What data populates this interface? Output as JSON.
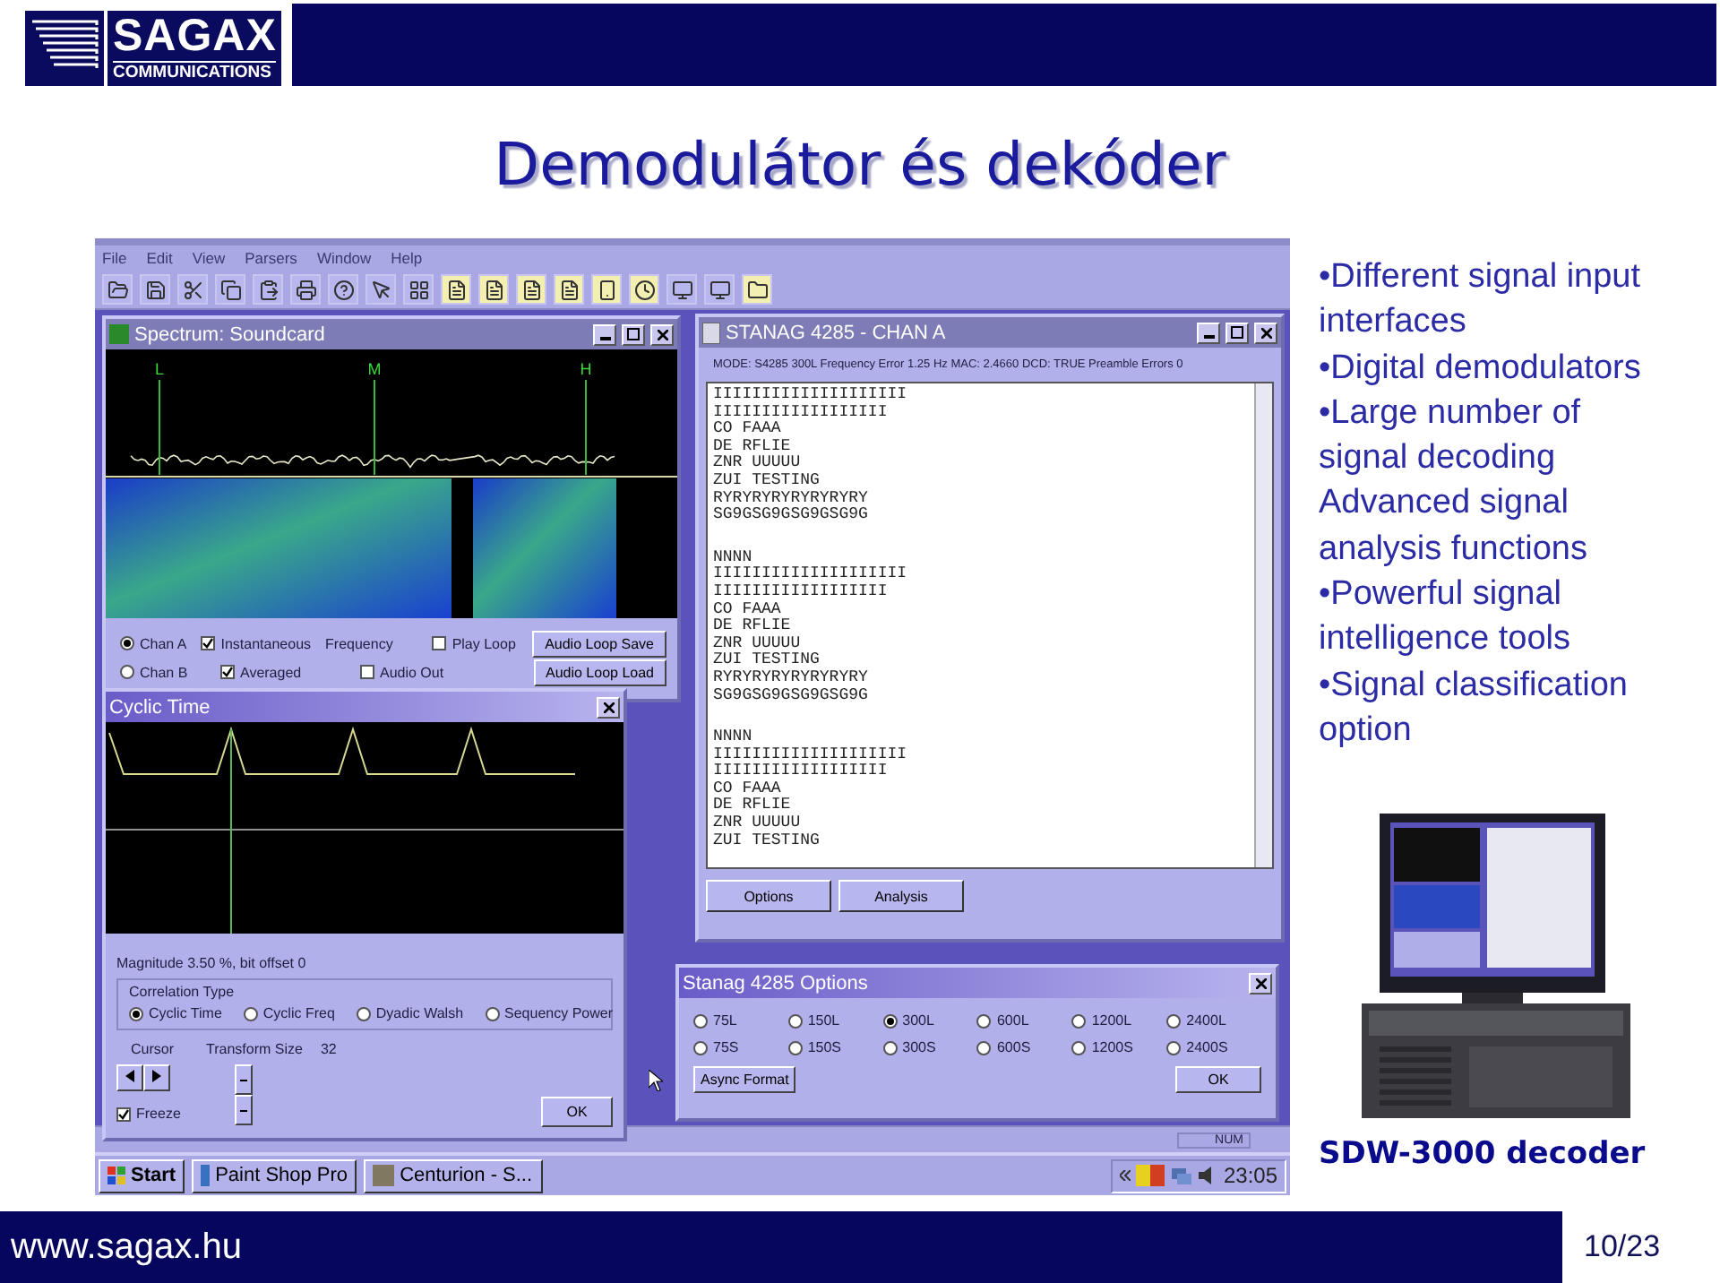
{
  "header": {
    "logo_name": "SAGAX",
    "logo_subtitle": "COMMUNICATIONS"
  },
  "title": "Demodulátor és dekóder",
  "app": {
    "menu": [
      "File",
      "Edit",
      "View",
      "Parsers",
      "Window",
      "Help"
    ],
    "spectrum": {
      "title": "Spectrum: Soundcard",
      "markers": [
        "L",
        "M",
        "H"
      ],
      "controls": [
        [
          {
            "kind": "radio",
            "label": "Chan A",
            "selected": true
          },
          {
            "kind": "checkbox",
            "label": "Instantaneous",
            "checked": true
          },
          {
            "kind": "label",
            "label": "Frequency"
          },
          {
            "kind": "checkbox",
            "label": "Play Loop",
            "checked": false
          },
          {
            "kind": "button",
            "label": "Audio Loop Save"
          }
        ],
        [
          {
            "kind": "radio",
            "label": "Chan B",
            "selected": false
          },
          {
            "kind": "checkbox",
            "label": "Averaged",
            "checked": true
          },
          {
            "kind": "checkbox",
            "label": "Audio Out",
            "checked": false
          },
          {
            "kind": "button",
            "label": "Audio Loop Load"
          }
        ]
      ]
    },
    "stanag": {
      "title": "STANAG 4285 - CHAN A",
      "status": "MODE: S4285 300L Frequency Error 1.25 Hz MAC: 2.4660 DCD: TRUE Preamble Errors 0",
      "blocks": [
        [
          "IIIIIIIIIIIIIIIIIIII",
          "IIIIIIIIIIIIIIIIII",
          "CO FAAA",
          "DE RFLIE",
          "ZNR UUUUU",
          "ZUI TESTING",
          "RYRYRYRYRYRYRYRY",
          "SG9GSG9GSG9GSG9G"
        ],
        [
          "NNNN",
          "IIIIIIIIIIIIIIIIIIII",
          "IIIIIIIIIIIIIIIIII",
          "CO FAAA",
          "DE RFLIE",
          "ZNR UUUUU",
          "ZUI TESTING",
          "RYRYRYRYRYRYRYRY",
          "SG9GSG9GSG9GSG9G"
        ],
        [
          "NNNN",
          "IIIIIIIIIIIIIIIIIIII",
          "IIIIIIIIIIIIIIIIII",
          "CO FAAA",
          "DE RFLIE",
          "ZNR UUUUU",
          "ZUI TESTING"
        ]
      ],
      "buttons": [
        "Options",
        "Analysis"
      ]
    },
    "cyclic": {
      "title": "Cyclic Time",
      "magnitude": "Magnitude 3.50 %, bit offset 0",
      "group_label": "Correlation Type",
      "options": [
        {
          "label": "Cyclic Time",
          "selected": true
        },
        {
          "label": "Cyclic Freq",
          "selected": false
        },
        {
          "label": "Dyadic Walsh",
          "selected": false
        },
        {
          "label": "Sequency Power",
          "selected": false
        }
      ],
      "cursor_label": "Cursor",
      "transform_label": "Transform Size",
      "transform_value": "32",
      "freeze": {
        "label": "Freeze",
        "checked": true
      },
      "ok": "OK"
    },
    "options_dialog": {
      "title": "Stanag 4285 Options",
      "rates": [
        {
          "label": "75L",
          "selected": false
        },
        {
          "label": "150L",
          "selected": false
        },
        {
          "label": "300L",
          "selected": true
        },
        {
          "label": "600L",
          "selected": false
        },
        {
          "label": "1200L",
          "selected": false
        },
        {
          "label": "2400L",
          "selected": false
        },
        {
          "label": "75S",
          "selected": false
        },
        {
          "label": "150S",
          "selected": false
        },
        {
          "label": "300S",
          "selected": false
        },
        {
          "label": "600S",
          "selected": false
        },
        {
          "label": "1200S",
          "selected": false
        },
        {
          "label": "2400S",
          "selected": false
        }
      ],
      "async_button": "Async Format",
      "ok": "OK"
    },
    "status": {
      "indicator": "NUM"
    },
    "taskbar": {
      "start": "Start",
      "tasks": [
        "Paint Shop Pro",
        "Centurion - S..."
      ],
      "clock": "23:05"
    }
  },
  "bullets": [
    "•Different signal input interfaces",
    "•Digital demodulators",
    "•Large number of signal decoding",
    "Advanced signal analysis functions",
    "•Powerful signal intelligence tools",
    "•Signal classification option"
  ],
  "product": {
    "caption": "SDW-3000 decoder"
  },
  "footer": {
    "url": "www.sagax.hu",
    "page": "10/23"
  }
}
